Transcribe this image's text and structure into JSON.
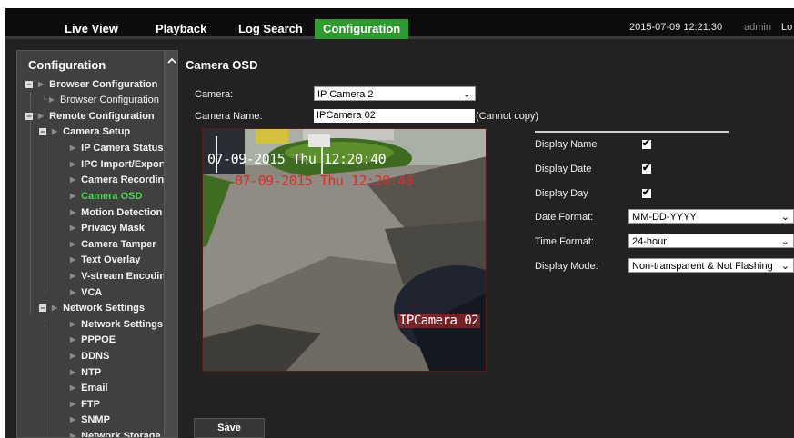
{
  "nav": {
    "tabs": [
      {
        "label": "Live View"
      },
      {
        "label": "Playback"
      },
      {
        "label": "Log Search"
      },
      {
        "label": "Configuration"
      }
    ],
    "datetime": "2015-07-09 12:21:30",
    "user": "admin",
    "logout": "Lo"
  },
  "sidebar": {
    "title": "Configuration",
    "items": [
      {
        "label": "Browser Configuration"
      },
      {
        "label": "Browser Configuration"
      },
      {
        "label": "Remote Configuration"
      },
      {
        "label": "Camera Setup"
      },
      {
        "label": "IP Camera Status"
      },
      {
        "label": "IPC Import/Export"
      },
      {
        "label": "Camera Recording S"
      },
      {
        "label": "Camera OSD"
      },
      {
        "label": "Motion Detection"
      },
      {
        "label": "Privacy Mask"
      },
      {
        "label": "Camera Tamper"
      },
      {
        "label": "Text Overlay"
      },
      {
        "label": "V-stream Encoding"
      },
      {
        "label": "VCA"
      },
      {
        "label": "Network Settings"
      },
      {
        "label": "Network Settings"
      },
      {
        "label": "PPPOE"
      },
      {
        "label": "DDNS"
      },
      {
        "label": "NTP"
      },
      {
        "label": "Email"
      },
      {
        "label": "FTP"
      },
      {
        "label": "SNMP"
      },
      {
        "label": "Network Storage"
      }
    ]
  },
  "main": {
    "title": "Camera OSD",
    "camera_label": "Camera:",
    "camera_value": "IP Camera 2",
    "camera_name_label": "Camera Name:",
    "camera_name_value": "IPCamera 02",
    "cannot_copy": "(Cannot copy)",
    "preview": {
      "time_osd": "07-09-2015 Thu 12:20:40",
      "time_osd_overlay": "07-09-2015 Thu 12:20:40",
      "name_osd": "IPCamera 02"
    },
    "options": {
      "display_name_label": "Display Name",
      "display_name_checked": true,
      "display_date_label": "Display Date",
      "display_date_checked": true,
      "display_day_label": "Display Day",
      "display_day_checked": true,
      "date_format_label": "Date Format:",
      "date_format_value": "MM-DD-YYYY",
      "time_format_label": "Time Format:",
      "time_format_value": "24-hour",
      "display_mode_label": "Display Mode:",
      "display_mode_value": "Non-transparent & Not Flashing"
    },
    "save_label": "Save",
    "check_glyph": "✔",
    "chevron_glyph": "⌄"
  },
  "colors": {
    "accent": "#2e9b2e",
    "active_item": "#4bd54b",
    "osd_red": "#e12a2a"
  }
}
